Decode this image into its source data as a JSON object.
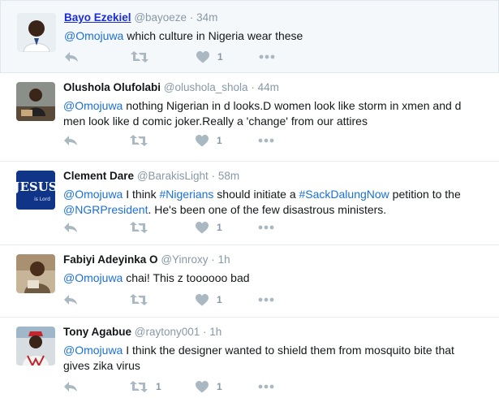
{
  "tweets": [
    {
      "name": "Bayo Ezekiel",
      "handle": "@bayoeze",
      "sep": "·",
      "time": "34m",
      "text": [
        {
          "t": "@Omojuwa",
          "k": "mention"
        },
        {
          "t": " which culture in Nigeria wear these",
          "k": "plain"
        }
      ],
      "likes": "1",
      "retweets": ""
    },
    {
      "name": "Olushola Olufolabi",
      "handle": "@olushola_shola",
      "sep": "·",
      "time": "44m",
      "text": [
        {
          "t": "@Omojuwa",
          "k": "mention"
        },
        {
          "t": " nothing Nigerian in d looks.D women look like storm in xmen and d men look like d comic joker.Really a 'change' from our attires",
          "k": "plain"
        }
      ],
      "likes": "1",
      "retweets": ""
    },
    {
      "name": "Clement Dare",
      "handle": "@BarakisLight",
      "sep": "·",
      "time": "58m",
      "text": [
        {
          "t": "@Omojuwa",
          "k": "mention"
        },
        {
          "t": " I think ",
          "k": "plain"
        },
        {
          "t": "#Nigerians",
          "k": "hashtag"
        },
        {
          "t": " should initiate a ",
          "k": "plain"
        },
        {
          "t": "#SackDalungNow",
          "k": "hashtag"
        },
        {
          "t": " petition to the ",
          "k": "plain"
        },
        {
          "t": "@NGRPresident",
          "k": "mention"
        },
        {
          "t": ". He's been one of the few disastrous ministers.",
          "k": "plain"
        }
      ],
      "likes": "1",
      "retweets": ""
    },
    {
      "name": "Fabiyi Adeyinka O",
      "handle": "@Yinroxy",
      "sep": "·",
      "time": "1h",
      "text": [
        {
          "t": "@Omojuwa",
          "k": "mention"
        },
        {
          "t": " chai! This z toooooo bad",
          "k": "plain"
        }
      ],
      "likes": "1",
      "retweets": ""
    },
    {
      "name": "Tony Agabue",
      "handle": "@raytony001",
      "sep": "·",
      "time": "1h",
      "text": [
        {
          "t": "@Omojuwa",
          "k": "mention"
        },
        {
          "t": " I think the designer wanted to shield them from mosquito bite that gives zika virus",
          "k": "plain"
        }
      ],
      "likes": "1",
      "retweets": "1"
    }
  ],
  "avatar_text": "JESUS",
  "avatar_subtext": "is Lord",
  "colors": {
    "mention": "#1b6fd8",
    "icon": "#aab8c2",
    "meta": "#8899a6",
    "highlight_bg": "#f5f8fa"
  },
  "icons": [
    "reply-icon",
    "retweet-icon",
    "heart-icon",
    "more-icon"
  ]
}
